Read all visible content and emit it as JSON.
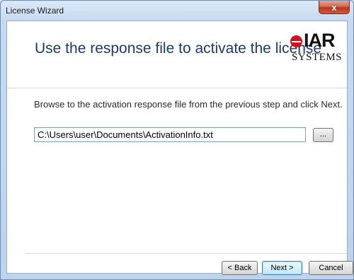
{
  "window": {
    "title": "License Wizard",
    "close_label": "x"
  },
  "header": {
    "heading": "Use the response file to activate the license",
    "logo": {
      "brand": "IAR",
      "sub": "SYSTEMS"
    }
  },
  "body": {
    "instruction": "Browse to the activation response file from the previous step and click Next.",
    "path_value": "C:\\Users\\user\\Documents\\ActivationInfo.txt",
    "browse_label": "..."
  },
  "footer": {
    "back_label": "< Back",
    "next_label": "Next >",
    "cancel_label": "Cancel"
  }
}
